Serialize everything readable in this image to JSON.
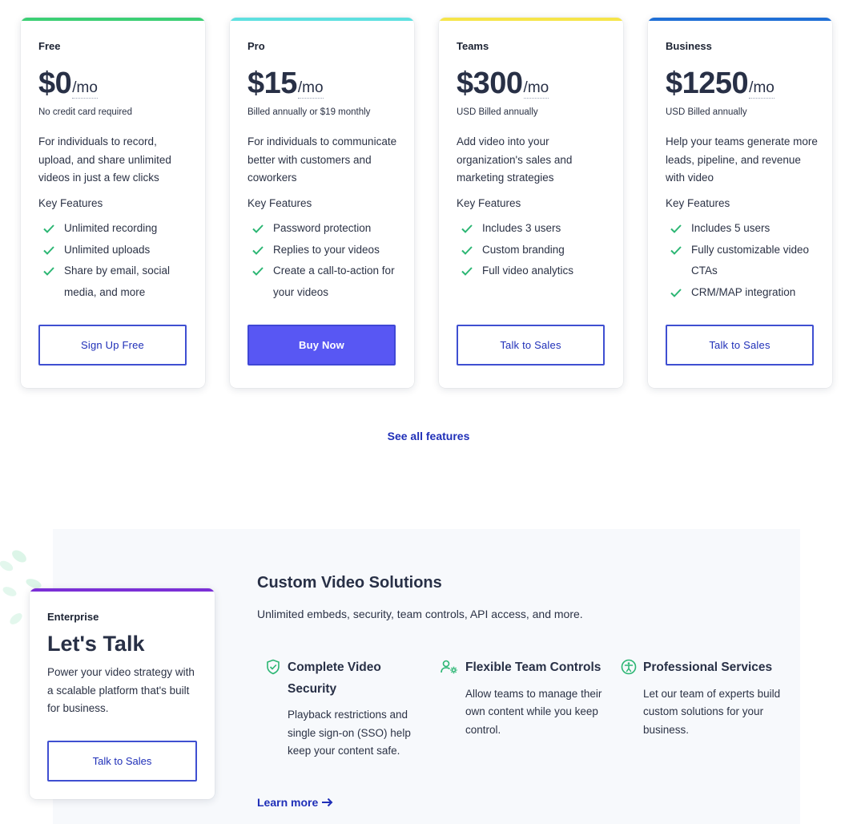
{
  "plans": [
    {
      "name": "Free",
      "price": "$0",
      "per": "/mo",
      "billing": "No credit card required",
      "description": "For individuals to record, upload, and share unlimited videos in just a few clicks",
      "key_features_label": "Key Features",
      "features": [
        "Unlimited recording",
        "Unlimited uploads",
        "Share by email, social media, and more"
      ],
      "cta": "Sign Up Free",
      "accent": "#3ccf74"
    },
    {
      "name": "Pro",
      "price": "$15",
      "per": "/mo",
      "billing": "Billed annually or $19 monthly",
      "description": "For individuals to communicate better with customers and coworkers",
      "key_features_label": "Key Features",
      "features": [
        "Password protection",
        "Replies to your videos",
        "Create a call-to-action for your videos"
      ],
      "cta": "Buy Now",
      "accent": "#5ee0e0"
    },
    {
      "name": "Teams",
      "price": "$300",
      "per": "/mo",
      "billing": "USD Billed annually",
      "description": "Add video into your organization's sales and marketing strategies",
      "key_features_label": "Key Features",
      "features": [
        "Includes 3 users",
        "Custom branding",
        "Full video analytics"
      ],
      "cta": "Talk to Sales",
      "accent": "#f6e54a"
    },
    {
      "name": "Business",
      "price": "$1250",
      "per": "/mo",
      "billing": "USD Billed annually",
      "description": "Help your teams generate more leads, pipeline, and revenue with video",
      "key_features_label": "Key Features",
      "features": [
        "Includes 5 users",
        "Fully customizable video CTAs",
        "CRM/MAP integration"
      ],
      "cta": "Talk to Sales",
      "accent": "#1f6fd6"
    }
  ],
  "see_all": "See all features",
  "enterprise": {
    "label": "Enterprise",
    "title": "Let's Talk",
    "description": "Power your video strategy with a scalable platform that's built for business.",
    "cta": "Talk to Sales",
    "accent": "#7b2fd6"
  },
  "custom": {
    "title": "Custom Video Solutions",
    "subtitle": "Unlimited embeds, security, team controls, API access, and more.",
    "features": [
      {
        "title": "Complete Video Security",
        "text": "Playback restrictions and single sign-on (SSO) help keep your content safe.",
        "icon": "shield-check-icon"
      },
      {
        "title": "Flexible Team Controls",
        "text": "Allow teams to manage their own content while you keep control.",
        "icon": "user-gear-icon"
      },
      {
        "title": "Professional Services",
        "text": "Let our team of experts build custom solutions for your business.",
        "icon": "accessibility-icon"
      }
    ],
    "learn_more": "Learn more"
  },
  "colors": {
    "brand_blue": "#1f2fb8",
    "primary_button": "#5857f3",
    "check_green": "#2bb673"
  }
}
